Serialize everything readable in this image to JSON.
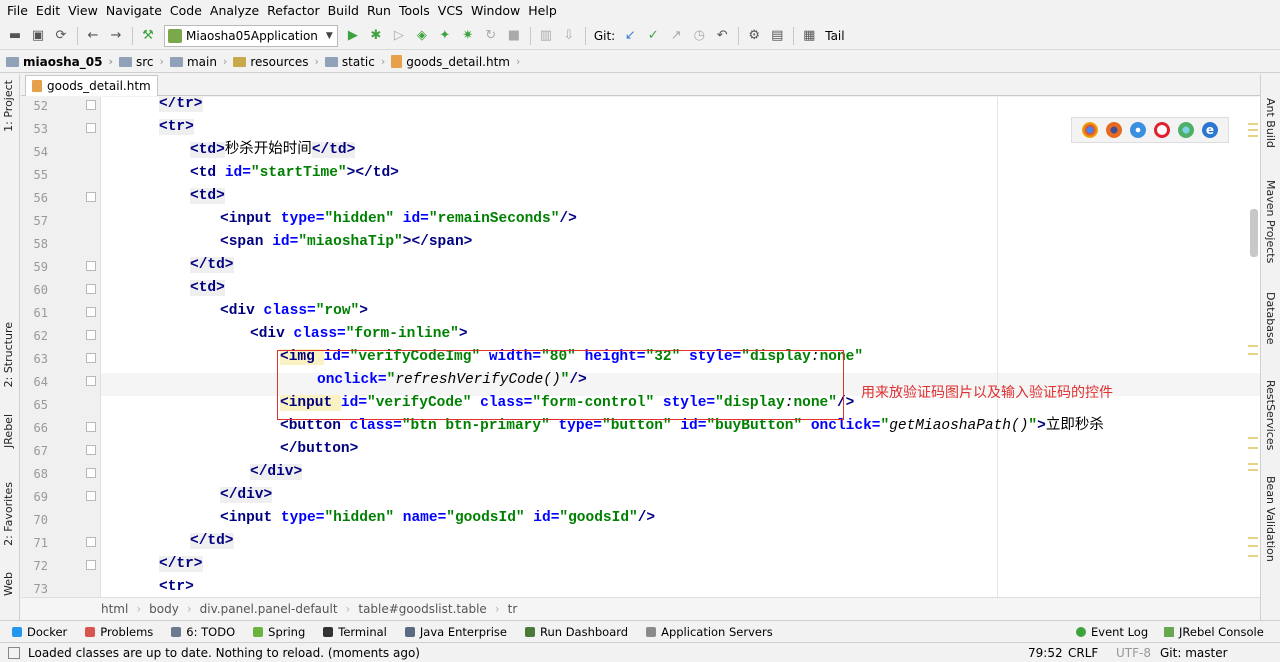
{
  "menu": [
    "File",
    "Edit",
    "View",
    "Navigate",
    "Code",
    "Analyze",
    "Refactor",
    "Build",
    "Run",
    "Tools",
    "VCS",
    "Window",
    "Help"
  ],
  "toolbar": {
    "run_config": "Miaosha05Application",
    "git_label": "Git:",
    "tail_label": "Tail"
  },
  "nav_crumbs": [
    "miaosha_05",
    "src",
    "main",
    "resources",
    "static",
    "goods_detail.htm"
  ],
  "left_tabs": [
    "1: Project",
    "2: Structure",
    "JRebel",
    "2: Favorites",
    "Web"
  ],
  "right_tabs": [
    "Ant Build",
    "Maven Projects",
    "Database",
    "RestServices",
    "Bean Validation"
  ],
  "editor": {
    "tab": "goods_detail.htm",
    "lines": [
      52,
      53,
      54,
      55,
      56,
      57,
      58,
      59,
      60,
      61,
      62,
      63,
      64,
      65,
      66,
      67,
      68,
      69,
      70,
      71,
      72,
      73
    ],
    "text": {
      "l54": "秒杀开始时间",
      "l66": "立即秒杀"
    },
    "annotation": "用来放验证码图片以及输入验证码的控件"
  },
  "editor_crumbs": [
    "html",
    "body",
    "div.panel.panel-default",
    "table#goodslist.table",
    "tr"
  ],
  "bottom_tools": [
    "Docker",
    "Problems",
    "6: TODO",
    "Spring",
    "Terminal",
    "Java Enterprise",
    "Run Dashboard",
    "Application Servers"
  ],
  "bottom_right_tools": [
    "Event Log",
    "JRebel Console"
  ],
  "status": {
    "message": "Loaded classes are up to date. Nothing to reload. (moments ago)",
    "position": "79:52",
    "line_sep": "CRLF",
    "encoding": "UTF-8",
    "git": "Git: master"
  },
  "colors": {
    "tag": "#000080",
    "attr": "#0000ff",
    "string": "#008000",
    "annotation": "#e03030"
  }
}
